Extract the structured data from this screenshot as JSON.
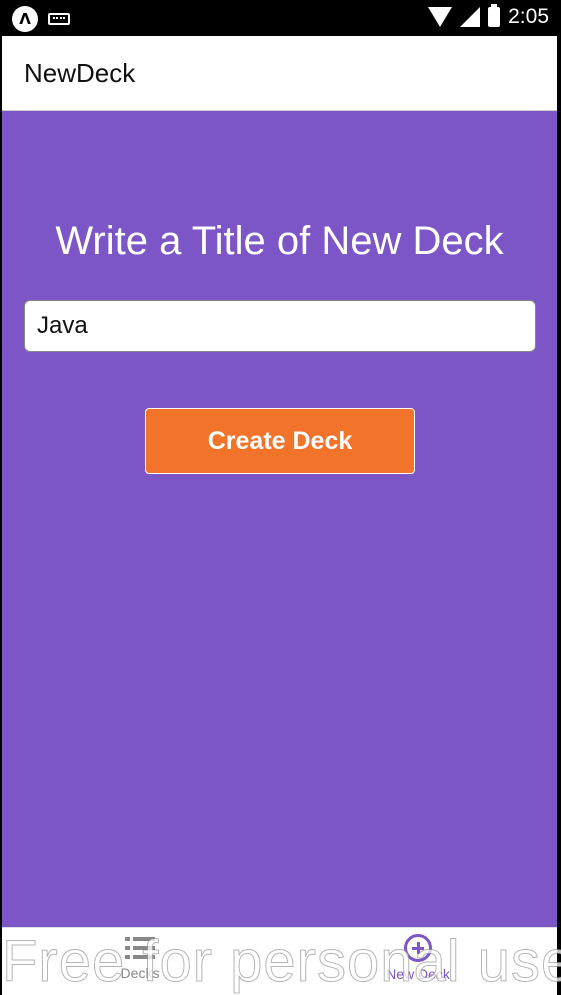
{
  "status_bar": {
    "app_badge": "Λ",
    "time": "2:05",
    "icons": [
      "app-icon",
      "keyboard-icon",
      "wifi-icon",
      "signal-icon",
      "battery-icon"
    ]
  },
  "header": {
    "title": "NewDeck"
  },
  "main": {
    "heading": "Write a Title of New Deck",
    "input_value": "Java",
    "create_button_label": "Create Deck"
  },
  "tabs": [
    {
      "label": "Decks",
      "icon": "list-icon",
      "active": false
    },
    {
      "label": "New Deck",
      "icon": "plus-circle-icon",
      "active": true
    }
  ],
  "watermark": "Free for personal use",
  "colors": {
    "primary": "#7c55c6",
    "accent": "#f2732a",
    "status_bar": "#000000"
  }
}
